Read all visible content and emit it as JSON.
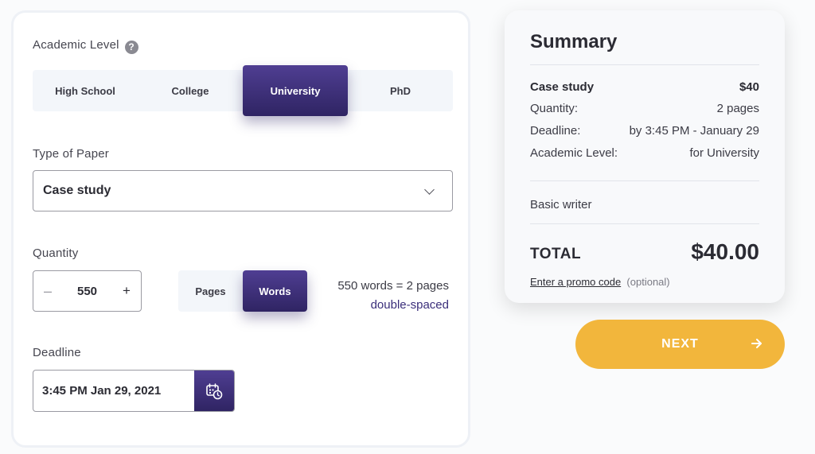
{
  "form": {
    "academic_level": {
      "label": "Academic Level",
      "help_glyph": "?",
      "options": [
        "High School",
        "College",
        "University",
        "PhD"
      ],
      "selected": "University"
    },
    "type_of_paper": {
      "label": "Type of Paper",
      "value": "Case study",
      "icon": "chevron-down-icon"
    },
    "quantity": {
      "label": "Quantity",
      "minus": "–",
      "value": "550",
      "plus": "+",
      "units": [
        "Pages",
        "Words"
      ],
      "selected_unit": "Words",
      "conversion": "550 words = 2 pages",
      "spacing": "double-spaced"
    },
    "deadline": {
      "label": "Deadline",
      "value": "3:45 PM Jan 29, 2021",
      "icon": "calendar-clock-icon"
    }
  },
  "summary": {
    "title": "Summary",
    "rows": [
      {
        "label": "Case study",
        "value": "$40"
      },
      {
        "label": "Quantity:",
        "value": "2 pages"
      },
      {
        "label": "Deadline:",
        "value": "by 3:45 PM - January 29"
      },
      {
        "label": "Academic Level:",
        "value": "for University"
      }
    ],
    "writer": "Basic writer",
    "total_label": "TOTAL",
    "total_value": "$40.00",
    "promo_link": "Enter a promo code",
    "promo_note": "(optional)"
  },
  "next_button": {
    "label": "NEXT",
    "icon": "arrow-right-icon"
  },
  "colors": {
    "primary": "#3a2e7a",
    "accent": "#f2b63c"
  }
}
